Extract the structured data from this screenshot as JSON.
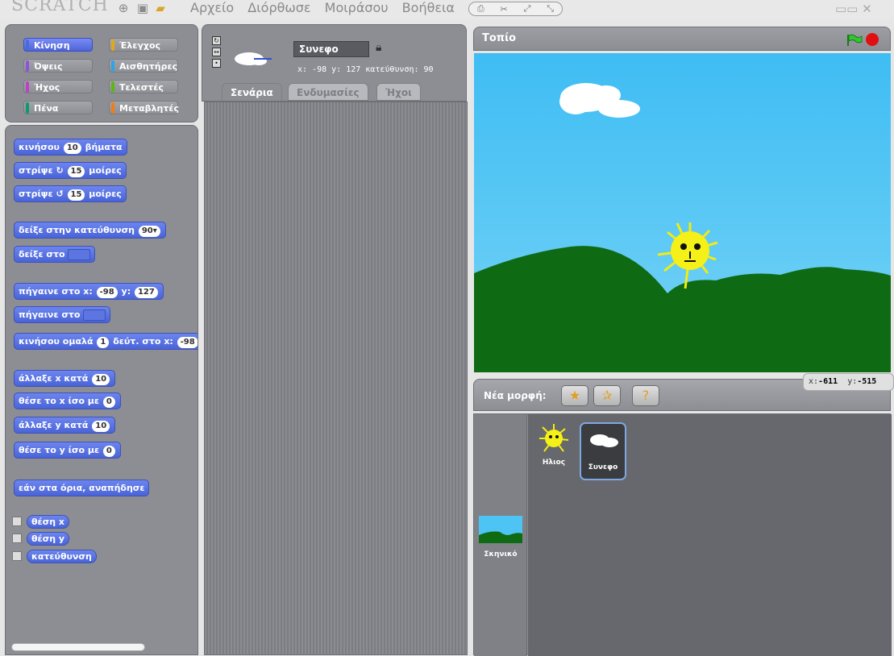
{
  "app": {
    "logo": "SCRATCH"
  },
  "menu": {
    "items": [
      "Αρχείο",
      "Διόρθωσε",
      "Μοιράσου",
      "Βοήθεια"
    ]
  },
  "categories": [
    {
      "label": "Κίνηση",
      "color": "#4a6cd4",
      "selected": true
    },
    {
      "label": "Έλεγχος",
      "color": "#e1a91a",
      "selected": false
    },
    {
      "label": "Όψεις",
      "color": "#8a55d7",
      "selected": false
    },
    {
      "label": "Αισθητήρες",
      "color": "#2ca5e2",
      "selected": false
    },
    {
      "label": "Ήχος",
      "color": "#bb42c3",
      "selected": false
    },
    {
      "label": "Τελεστές",
      "color": "#5cb712",
      "selected": false
    },
    {
      "label": "Πένα",
      "color": "#0e9a6c",
      "selected": false
    },
    {
      "label": "Μεταβλητές",
      "color": "#ee7d16",
      "selected": false
    }
  ],
  "blocks": {
    "move_label": "κινήσου",
    "move_value": "10",
    "move_unit": "βήματα",
    "turn_r_label": "στρίψε",
    "turn_r_value": "15",
    "turn_r_unit": "μοίρες",
    "turn_l_label": "στρίψε",
    "turn_l_value": "15",
    "turn_l_unit": "μοίρες",
    "point_dir_label": "δείξε στην κατεύθυνση",
    "point_dir_value": "90",
    "point_to_label": "δείξε στο",
    "goto_xy_label": "πήγαινε στο x:",
    "goto_x": "-98",
    "goto_y_label": "y:",
    "goto_y": "127",
    "goto_label": "πήγαινε στο",
    "glide_label": "κινήσου ομαλά",
    "glide_secs": "1",
    "glide_mid": "δεύτ. στο x:",
    "glide_x": "-98",
    "change_x_label": "άλλαξε x κατά",
    "change_x_value": "10",
    "set_x_label": "θέσε το x ίσο με",
    "set_x_value": "0",
    "change_y_label": "άλλαξε y κατά",
    "change_y_value": "10",
    "set_y_label": "θέσε το y ίσο με",
    "set_y_value": "0",
    "bounce_label": "εάν στα όρια, αναπήδησε",
    "rep_x": "θέση x",
    "rep_y": "θέση y",
    "rep_dir": "κατεύθυνση"
  },
  "sprite": {
    "name": "Συνεφο",
    "coords": "x: -98  y: 127  κατεύθυνση: 90"
  },
  "tabs": [
    "Σενάρια",
    "Ενδυμασίες",
    "Ήχοι"
  ],
  "stage": {
    "title": "Τοπίο"
  },
  "newsprite": {
    "label": "Νέα μορφή:"
  },
  "mouse": {
    "x_label": "x:",
    "x": "-611",
    "y_label": "y:",
    "y": "-515"
  },
  "sprites": [
    {
      "name": "Ηλιος",
      "selected": false
    },
    {
      "name": "Συνεφο",
      "selected": true
    }
  ],
  "stage_thumb": {
    "label": "Σκηνικό"
  }
}
